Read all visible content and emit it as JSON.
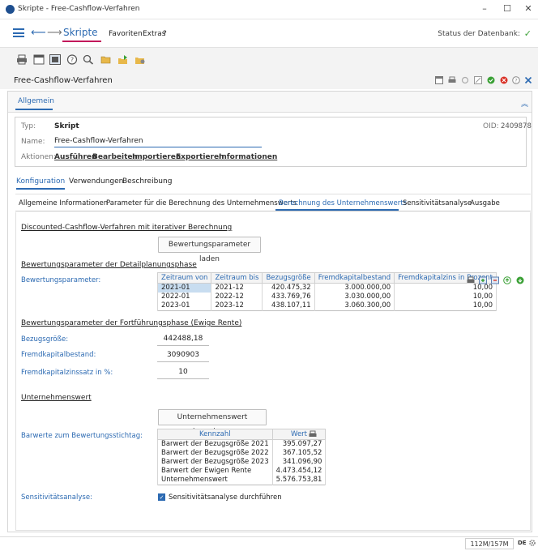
{
  "window": {
    "title": "Skripte - Free-Cashflow-Verfahren",
    "minimize": "–",
    "maximize": "☐",
    "close": "✕"
  },
  "menubar": {
    "back": "⟵",
    "forward": "⟶",
    "skripte": "Skripte",
    "favoriten": "Favoriten",
    "extras": "Extras",
    "help": "?",
    "status_db": "Status der Datenbank:",
    "status_check": "✓"
  },
  "toolbar": {
    "icons": [
      "print-icon",
      "window-icon",
      "panel-icon",
      "help-icon",
      "search-icon",
      "folder-open-icon",
      "export-icon",
      "settings-icon"
    ]
  },
  "doc": {
    "title": "Free-Cashflow-Verfahren",
    "header_icons": [
      "window-icon",
      "print-icon",
      "refresh-icon",
      "edit-icon",
      "ok-icon",
      "cancel-icon",
      "help-icon",
      "close-icon"
    ]
  },
  "allgemein": {
    "tab": "Allgemein",
    "typ_label": "Typ:",
    "typ_value": "Skript",
    "oid_label": "OID:",
    "oid_value": "2409878",
    "name_label": "Name:",
    "name_value": "Free-Cashflow-Verfahren",
    "aktionen_label": "Aktionen:",
    "actions": [
      "Ausführen",
      "Bearbeiten",
      "Importieren",
      "Exportieren",
      "Informationen"
    ]
  },
  "tabs_main": [
    "Konfiguration",
    "Verwendungen",
    "Beschreibung"
  ],
  "tabs_sub": [
    "Allgemeine Informationen",
    "Parameter für die Berechnung des Unternehmenswerts",
    "Berechnung des Unternehmenswerts",
    "Sensitivitätsanalyse",
    "Ausgabe"
  ],
  "content": {
    "section1": "Discounted-Cashflow-Verfahren mit iterativer Berechnung",
    "btn_load": "Bewertungsparameter laden",
    "section2": "Bewertungsparameter der Detailplanungsphase",
    "bewertungsparameter_label": "Bewertungsparameter:",
    "param_table": {
      "headers": [
        "Zeitraum von",
        "Zeitraum bis",
        "Bezugsgröße",
        "Fremdkapitalbestand",
        "Fremdkapitalzins in Prozent"
      ],
      "rows": [
        [
          "2021-01",
          "2021-12",
          "420.475,32",
          "3.000.000,00",
          "10,00"
        ],
        [
          "2022-01",
          "2022-12",
          "433.769,76",
          "3.030.000,00",
          "10,00"
        ],
        [
          "2023-01",
          "2023-12",
          "438.107,11",
          "3.060.300,00",
          "10,00"
        ]
      ]
    },
    "section3": "Bewertungsparameter der Fortführungsphase (Ewige Rente)",
    "bezugsgroesse_label": "Bezugsgröße:",
    "bezugsgroesse_value": "442488,18",
    "fremdkapitalbestand_label": "Fremdkapitalbestand:",
    "fremdkapitalbestand_value": "3090903",
    "fremdkapitalzins_label": "Fremdkapitalzinssatz in %:",
    "fremdkapitalzins_value": "10",
    "section4": "Unternehmenswert",
    "btn_calc": "Unternehmenswert berechnen",
    "barwerte_label": "Barwerte zum Bewertungsstichtag:",
    "barwerte_table": {
      "headers": [
        "Kennzahl",
        "Wert"
      ],
      "rows": [
        [
          "Barwert der Bezugsgröße 2021",
          "395.097,27"
        ],
        [
          "Barwert der Bezugsgröße 2022",
          "367.105,52"
        ],
        [
          "Barwert der Bezugsgröße 2023",
          "341.096,90"
        ],
        [
          "Barwert der Ewigen Rente",
          "4.473.454,12"
        ],
        [
          "Unternehmenswert",
          "5.576.753,81"
        ]
      ]
    },
    "sensitivity_label": "Sensitivitätsanalyse:",
    "sensitivity_checkbox": "Sensitivitätsanalyse durchführen"
  },
  "statusbar": {
    "memory": "112M/157M",
    "lang": "DE"
  },
  "colors": {
    "accent": "#2c6ab2",
    "skripte_underline": "#c2185b",
    "ok_green": "#3aa035",
    "cancel_red": "#d93025"
  }
}
